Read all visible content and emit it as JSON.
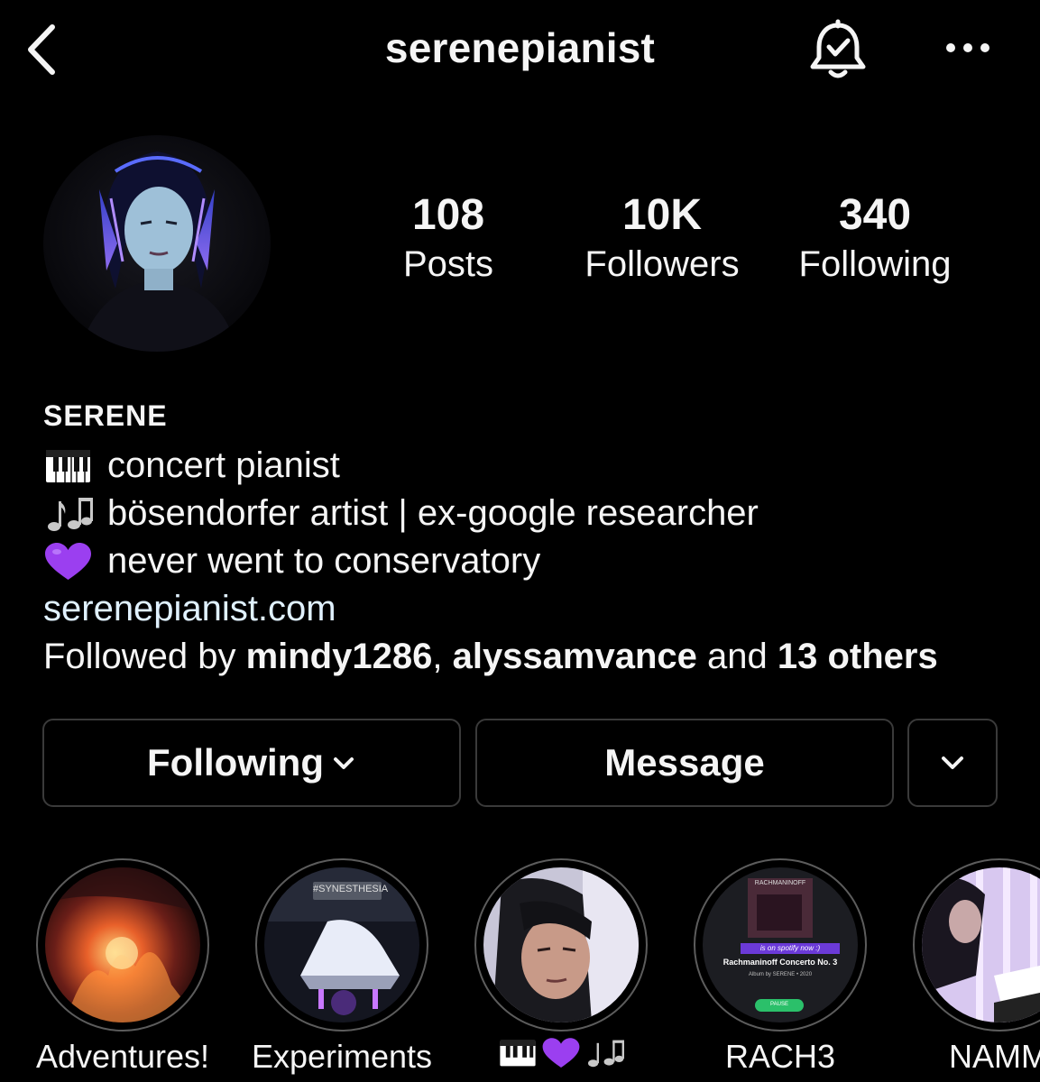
{
  "header": {
    "username": "serenepianist",
    "back_icon": "chevron-left-icon",
    "bell_icon": "bell-check-icon",
    "more_icon": "more-horizontal-icon"
  },
  "stats": {
    "posts": {
      "value": "108",
      "label": "Posts"
    },
    "followers": {
      "value": "10K",
      "label": "Followers"
    },
    "following": {
      "value": "340",
      "label": "Following"
    }
  },
  "bio": {
    "display_name": "SERENE",
    "lines": [
      {
        "emoji": "piano-icon",
        "text": "concert pianist"
      },
      {
        "emoji": "music-notes-icon",
        "text": "bösendorfer artist | ex-google researcher"
      },
      {
        "emoji": "purple-heart-icon",
        "text": "never went to conservatory"
      }
    ],
    "website": "serenepianist.com",
    "followed_by": {
      "prefix": "Followed by ",
      "user1": "mindy1286",
      "sep": ", ",
      "user2": "alyssamvance",
      "and": " and ",
      "others": "13 others"
    }
  },
  "actions": {
    "following_label": "Following",
    "message_label": "Message"
  },
  "highlights": [
    {
      "label": "Adventures!"
    },
    {
      "label": "Experiments",
      "cover_text": "#SYNESTHESIA"
    },
    {
      "label": "🎹💜🎶"
    },
    {
      "label": "RACH3",
      "cover_title": "RACHMANINOFF",
      "cover_sticker": "is on spotify now :)",
      "cover_song": "Rachmaninoff Concerto No. 3",
      "cover_sub": "Album by SERENE • 2020",
      "cover_button": "PAUSE"
    },
    {
      "label": "NAMM"
    }
  ],
  "colors": {
    "background": "#000000",
    "text": "#f5f5f5",
    "link": "#e0f1ff",
    "border": "#3a3a3a",
    "heart": "#9b3ff0"
  }
}
